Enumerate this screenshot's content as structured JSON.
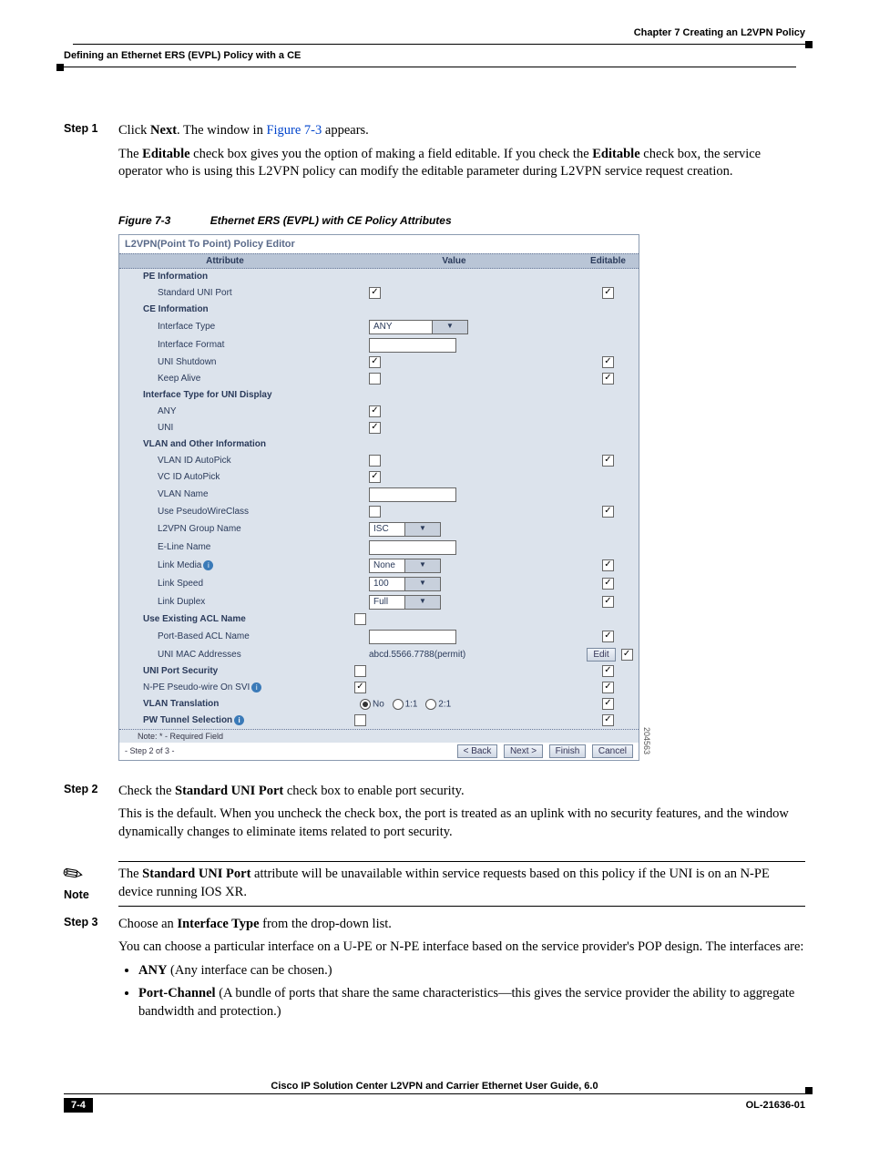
{
  "header": {
    "right": "Chapter 7    Creating an L2VPN Policy",
    "left": "Defining an Ethernet ERS (EVPL) Policy with a CE"
  },
  "steps": {
    "s1": {
      "label": "Step 1",
      "p1a": "Click ",
      "p1b": "Next",
      "p1c": ". The window in ",
      "p1link": "Figure 7-3",
      "p1d": " appears.",
      "p2a": "The ",
      "p2b": "Editable",
      "p2c": " check box gives you the option of making a field editable. If you check the ",
      "p2d": "Editable",
      "p2e": " check box, the service operator who is using this L2VPN policy can modify the editable parameter during L2VPN service request creation."
    },
    "s2": {
      "label": "Step 2",
      "p1a": "Check the ",
      "p1b": "Standard UNI Port",
      "p1c": " check box to enable port security.",
      "p2": "This is the default. When you uncheck the check box, the port is treated as an uplink with no security features, and the window dynamically changes to eliminate items related to port security."
    },
    "s3": {
      "label": "Step 3",
      "p1a": "Choose an ",
      "p1b": "Interface Type",
      "p1c": " from the drop-down list.",
      "p2": "You can choose a particular interface on a U-PE or N-PE interface based on the service provider's POP design. The interfaces are:",
      "li1a": "ANY",
      "li1b": " (Any interface can be chosen.)",
      "li2a": "Port-Channel",
      "li2b": " (A bundle of ports that share the same characteristics—this gives the service provider the ability to aggregate bandwidth and protection.)"
    }
  },
  "figure": {
    "num": "Figure 7-3",
    "title": "Ethernet ERS (EVPL) with CE Policy Attributes"
  },
  "screenshot": {
    "title": "L2VPN(Point To Point) Policy Editor",
    "cols": {
      "attr": "Attribute",
      "val": "Value",
      "ed": "Editable"
    },
    "sections": {
      "pe": "PE Information",
      "ce": "CE Information",
      "itype": "Interface Type for UNI Display",
      "vlan": "VLAN and Other Information",
      "acl": "Use Existing ACL Name",
      "unips": "UNI Port Security",
      "vlantrans": "VLAN Translation",
      "pwtun": "PW Tunnel Selection"
    },
    "rows": {
      "stduni": "Standard UNI Port",
      "iftype": "Interface Type",
      "iffmt": "Interface Format",
      "unishut": "UNI Shutdown",
      "keep": "Keep Alive",
      "any": "ANY",
      "uni": "UNI",
      "vlanauto": "VLAN ID AutoPick",
      "vcauto": "VC ID AutoPick",
      "vlanname": "VLAN Name",
      "pwclass": "Use PseudoWireClass",
      "l2grp": "L2VPN Group Name",
      "eline": "E-Line Name",
      "lmedia": "Link Media",
      "lspeed": "Link Speed",
      "lduplex": "Link Duplex",
      "aclname": "Port-Based ACL Name",
      "unimac": "UNI MAC Addresses",
      "npe": "N-PE Pseudo-wire On SVI"
    },
    "vals": {
      "iftype": "ANY",
      "l2grp": "ISC",
      "lmedia": "None",
      "lspeed": "100",
      "lduplex": "Full",
      "unimac": "abcd.5566.7788(permit)",
      "radio": {
        "no": "No",
        "oneone": "1:1",
        "twoone": "2:1"
      }
    },
    "buttons": {
      "edit": "Edit",
      "back": "< Back",
      "next": "Next >",
      "finish": "Finish",
      "cancel": "Cancel"
    },
    "footnote": "Note: * - Required Field",
    "stepnote": "- Step 2 of 3 -",
    "sidenum": "204563"
  },
  "note": {
    "label": "Note",
    "text_a": "The ",
    "text_b": "Standard UNI Port",
    "text_c": " attribute will be unavailable within service requests based on this policy if the UNI is on an N-PE device running IOS XR."
  },
  "footer": {
    "title": "Cisco IP Solution Center L2VPN and Carrier Ethernet User Guide, 6.0",
    "page": "7-4",
    "docid": "OL-21636-01"
  }
}
